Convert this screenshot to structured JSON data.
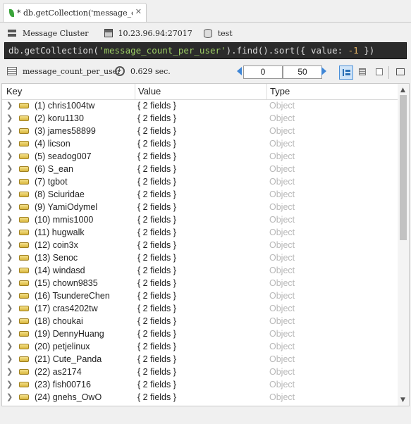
{
  "tab": {
    "title": "* db.getCollection('message_co…",
    "close": "✕"
  },
  "info": {
    "cluster": "Message Cluster",
    "server": "10.23.96.94:27017",
    "database": "test"
  },
  "query": {
    "prefix": "db.getCollection(",
    "collection_str": "'message_count_per_user'",
    "middle": ").find().sort({ value: ",
    "number": "-1",
    "suffix": " })"
  },
  "toolbar": {
    "collection": "message_count_per_user",
    "time": "0.629 sec.",
    "skip": "0",
    "limit": "50"
  },
  "table": {
    "headers": {
      "key": "Key",
      "value": "Value",
      "type": "Type"
    },
    "rows": [
      {
        "key": "(1) chris1004tw",
        "value": "{ 2 fields }",
        "type": "Object"
      },
      {
        "key": "(2) koru1130",
        "value": "{ 2 fields }",
        "type": "Object"
      },
      {
        "key": "(3) james58899",
        "value": "{ 2 fields }",
        "type": "Object"
      },
      {
        "key": "(4) licson",
        "value": "{ 2 fields }",
        "type": "Object"
      },
      {
        "key": "(5) seadog007",
        "value": "{ 2 fields }",
        "type": "Object"
      },
      {
        "key": "(6) S_ean",
        "value": "{ 2 fields }",
        "type": "Object"
      },
      {
        "key": "(7) tgbot",
        "value": "{ 2 fields }",
        "type": "Object"
      },
      {
        "key": "(8) Sciuridae",
        "value": "{ 2 fields }",
        "type": "Object"
      },
      {
        "key": "(9) YamiOdymel",
        "value": "{ 2 fields }",
        "type": "Object"
      },
      {
        "key": "(10) mmis1000",
        "value": "{ 2 fields }",
        "type": "Object"
      },
      {
        "key": "(11) hugwalk",
        "value": "{ 2 fields }",
        "type": "Object"
      },
      {
        "key": "(12) coin3x",
        "value": "{ 2 fields }",
        "type": "Object"
      },
      {
        "key": "(13) Senoc",
        "value": "{ 2 fields }",
        "type": "Object"
      },
      {
        "key": "(14) windasd",
        "value": "{ 2 fields }",
        "type": "Object"
      },
      {
        "key": "(15) chown9835",
        "value": "{ 2 fields }",
        "type": "Object"
      },
      {
        "key": "(16) TsundereChen",
        "value": "{ 2 fields }",
        "type": "Object"
      },
      {
        "key": "(17) cras4202tw",
        "value": "{ 2 fields }",
        "type": "Object"
      },
      {
        "key": "(18) choukai",
        "value": "{ 2 fields }",
        "type": "Object"
      },
      {
        "key": "(19) DennyHuang",
        "value": "{ 2 fields }",
        "type": "Object"
      },
      {
        "key": "(20) petjelinux",
        "value": "{ 2 fields }",
        "type": "Object"
      },
      {
        "key": "(21) Cute_Panda",
        "value": "{ 2 fields }",
        "type": "Object"
      },
      {
        "key": "(22) as2174",
        "value": "{ 2 fields }",
        "type": "Object"
      },
      {
        "key": "(23) fish00716",
        "value": "{ 2 fields }",
        "type": "Object"
      },
      {
        "key": "(24) gnehs_OwO",
        "value": "{ 2 fields }",
        "type": "Object"
      }
    ]
  }
}
